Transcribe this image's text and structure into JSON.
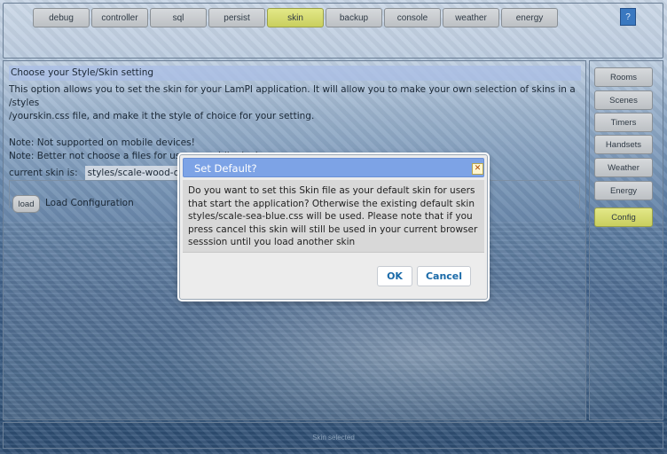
{
  "nav": {
    "tabs": [
      {
        "label": "debug"
      },
      {
        "label": "controller"
      },
      {
        "label": "sql"
      },
      {
        "label": "persist"
      },
      {
        "label": "skin"
      },
      {
        "label": "backup"
      },
      {
        "label": "console"
      },
      {
        "label": "weather"
      },
      {
        "label": "energy"
      }
    ],
    "active_tab": "skin",
    "help_label": "?"
  },
  "main": {
    "section_title": "Choose your Style/Skin setting",
    "description": [
      "This option allows you to set the skin for your LamPI application. It will allow you to make your own selection of skins in a /styles",
      "/yourskin.css file, and make it the style of choice for your setting.",
      "",
      "Note: Not supported on mobile devices!",
      "Note: Better not choose a files for use on mobile devices ..."
    ],
    "current_skin_label": "current skin is:",
    "current_skin_value": "styles/scale-wood-oran",
    "load_button": "load",
    "load_label": "Load Configuration"
  },
  "sidebar": {
    "items": [
      {
        "label": "Rooms"
      },
      {
        "label": "Scenes"
      },
      {
        "label": "Timers"
      },
      {
        "label": "Handsets"
      },
      {
        "label": "Weather"
      },
      {
        "label": "Energy"
      },
      {
        "label": "Config"
      }
    ],
    "active_item": "Config"
  },
  "footer": {
    "text": "Skin selected"
  },
  "dialog": {
    "title": "Set Default?",
    "close_label": "✕",
    "message": "Do you want to set this Skin file as your default skin for users that start the application? Otherwise the existing default skin styles/scale-sea-blue.css will be used. Please note that if you press cancel this skin will still be used in your current browser sesssion until you load another skin",
    "ok_label": "OK",
    "cancel_label": "Cancel"
  },
  "colors": {
    "active_tab": "#d4d96c",
    "dialog_titlebar": "#7da3e6",
    "button_text": "#1a6aa8"
  }
}
